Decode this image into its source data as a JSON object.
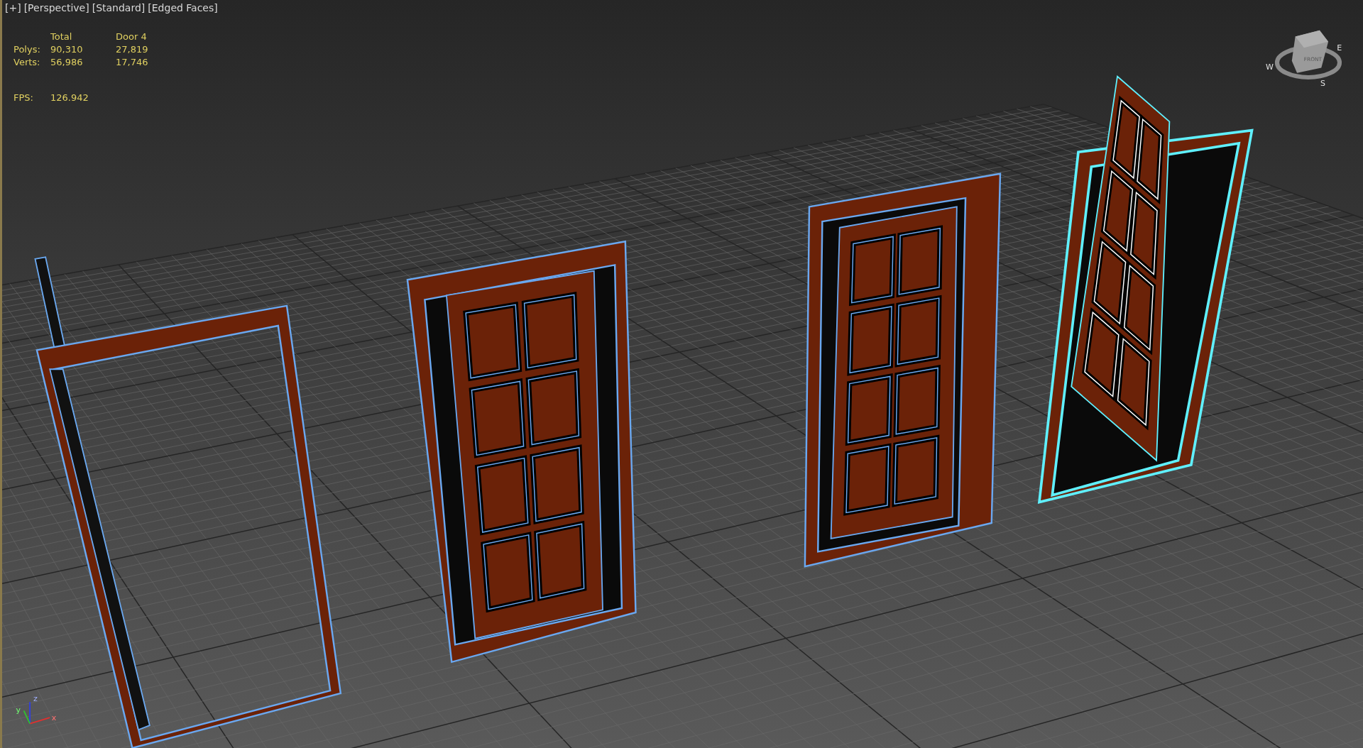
{
  "viewport": {
    "labels": [
      "[+]",
      "[Perspective]",
      "[Standard]",
      "[Edged Faces]"
    ]
  },
  "stats": {
    "headers": [
      "Total",
      "Door 4"
    ],
    "rows": [
      {
        "label": "Polys:",
        "values": [
          "90,310",
          "27,819"
        ]
      },
      {
        "label": "Verts:",
        "values": [
          "56,986",
          "17,746"
        ]
      }
    ],
    "fps": {
      "label": "FPS:",
      "value": "126.942"
    }
  },
  "objects": [
    {
      "selected": false
    },
    {
      "selected": false
    },
    {
      "selected": false
    },
    {
      "selected": true
    }
  ],
  "viewcube": {
    "face": "FRONT",
    "compass": [
      "E",
      "W",
      "S"
    ]
  },
  "axis_tripod": {
    "labels": [
      "z",
      "y",
      "x"
    ]
  }
}
